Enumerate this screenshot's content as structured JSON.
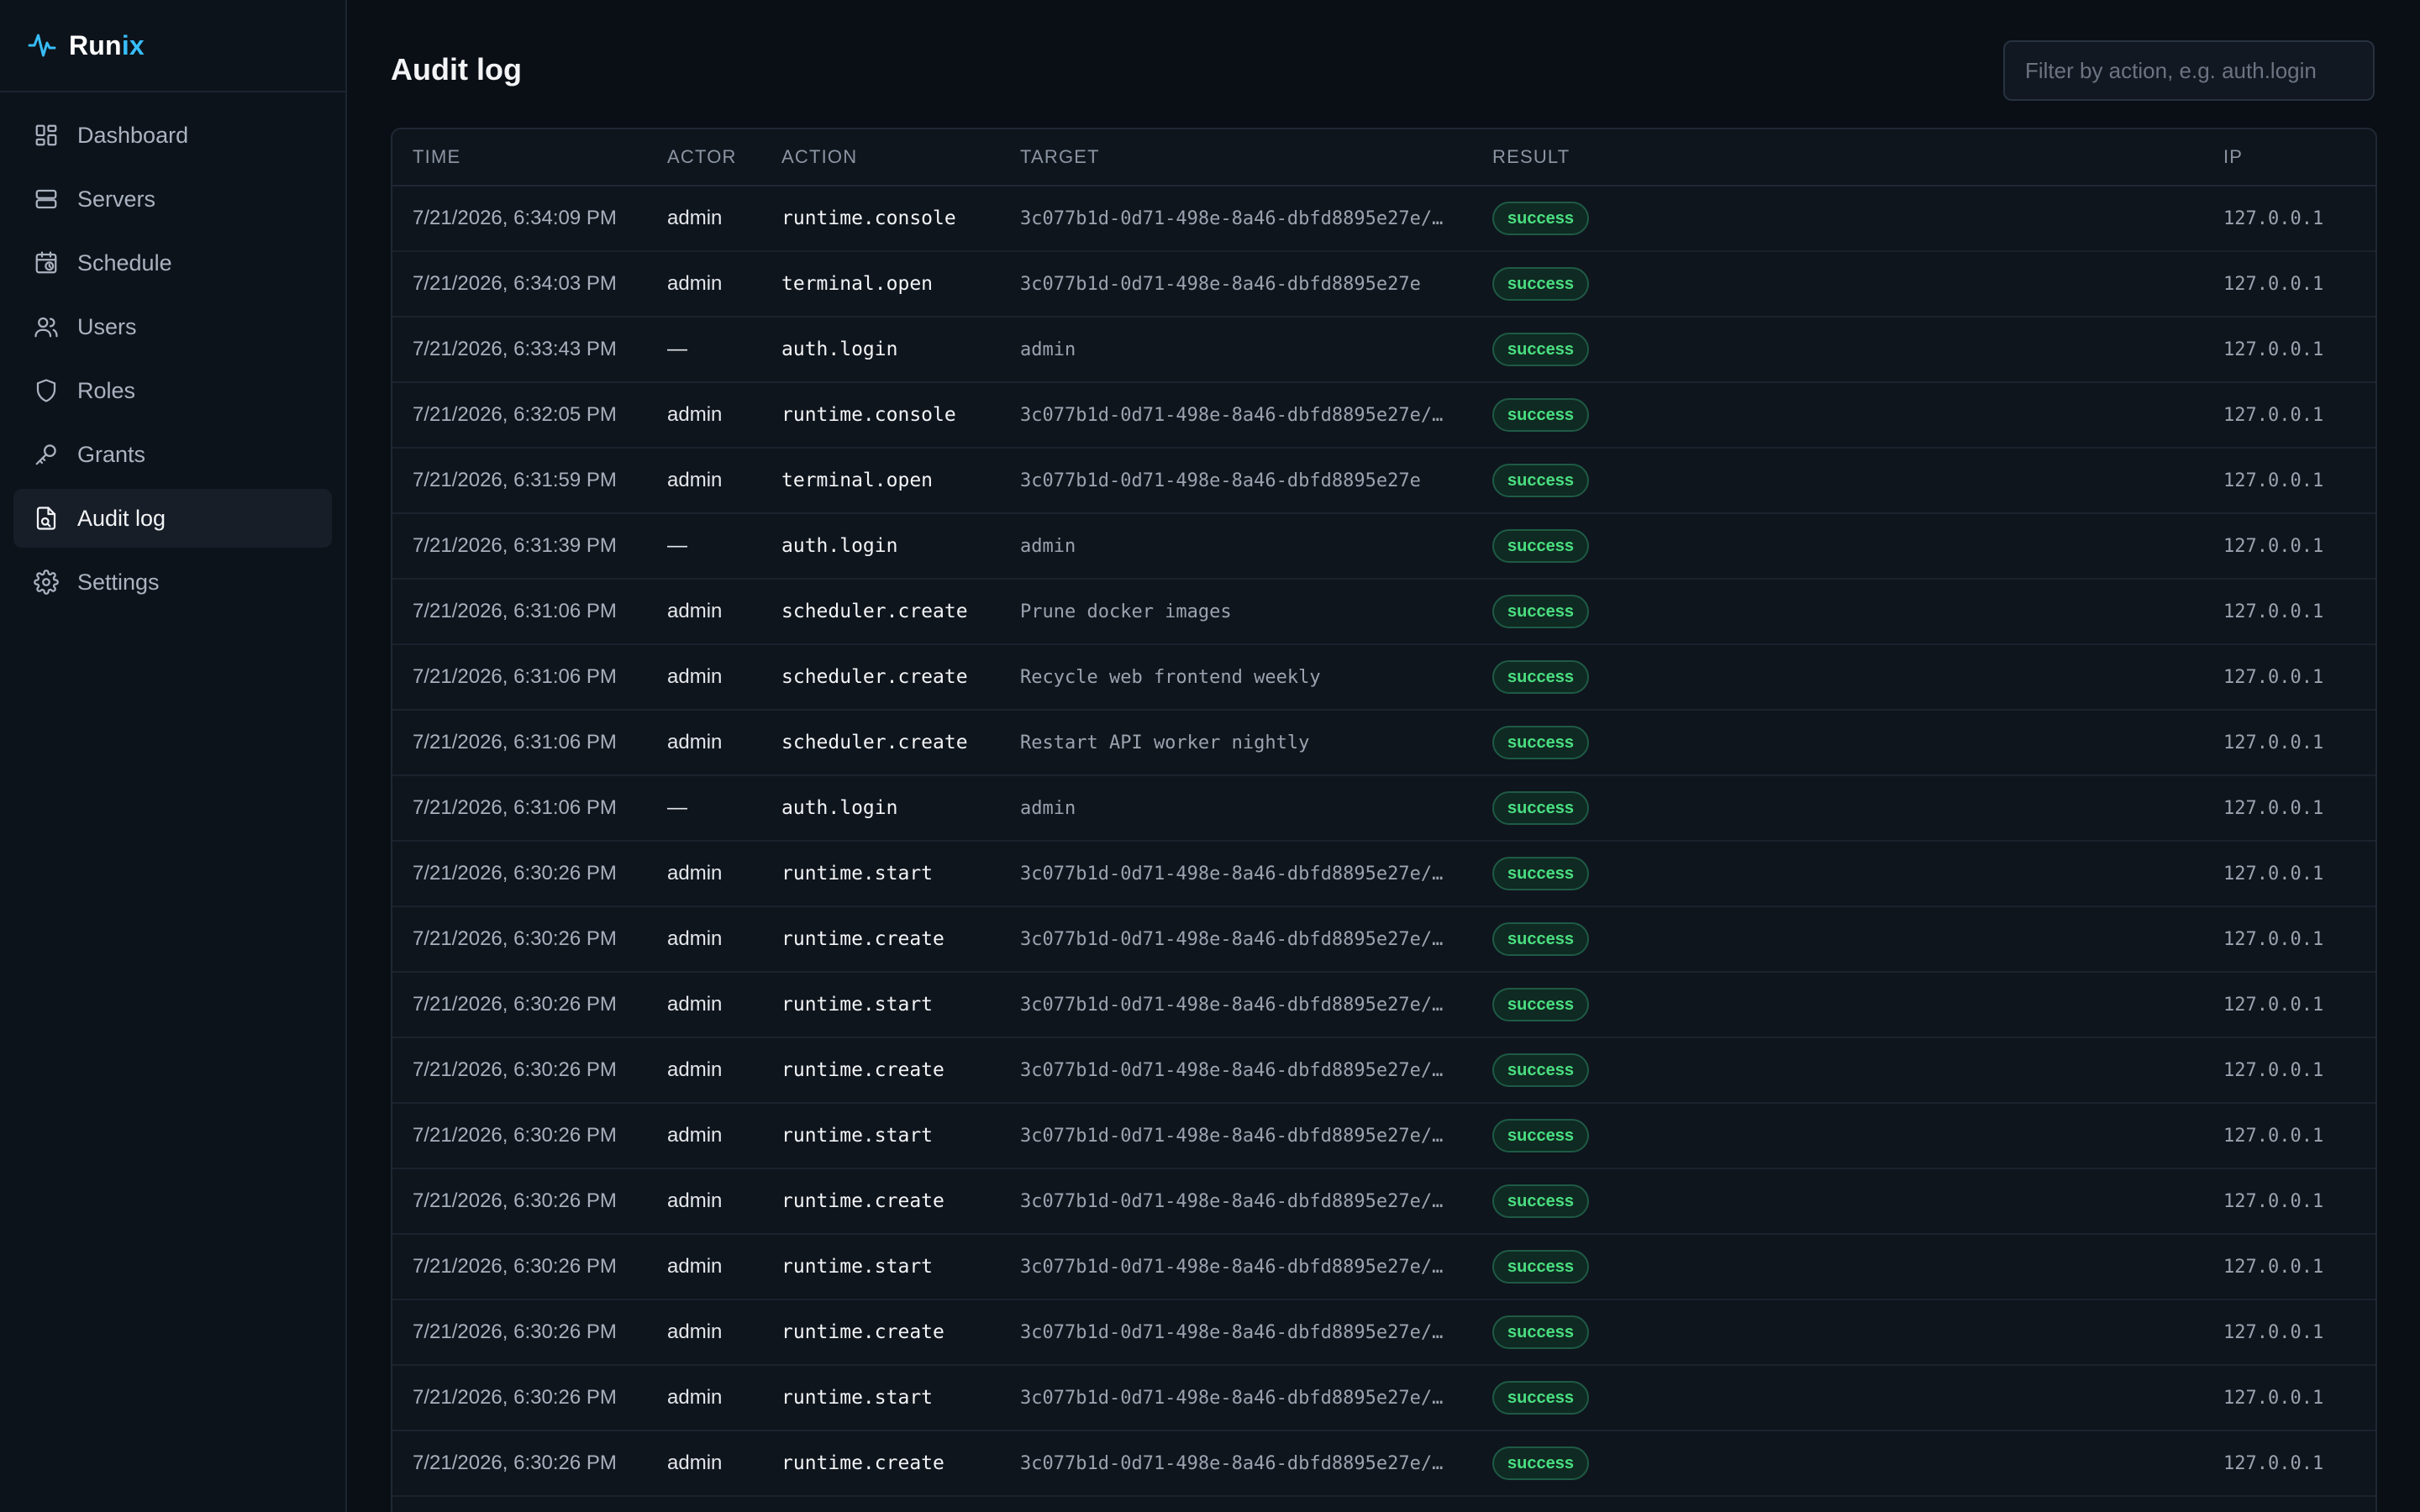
{
  "app": {
    "name_main": "Run",
    "name_accent": "ix"
  },
  "sidebar": {
    "items": [
      {
        "label": "Dashboard",
        "icon": "dashboard-icon",
        "active": false
      },
      {
        "label": "Servers",
        "icon": "servers-icon",
        "active": false
      },
      {
        "label": "Schedule",
        "icon": "calendar-clock-icon",
        "active": false
      },
      {
        "label": "Users",
        "icon": "users-icon",
        "active": false
      },
      {
        "label": "Roles",
        "icon": "shield-icon",
        "active": false
      },
      {
        "label": "Grants",
        "icon": "key-icon",
        "active": false
      },
      {
        "label": "Audit log",
        "icon": "audit-file-icon",
        "active": true
      },
      {
        "label": "Settings",
        "icon": "gear-icon",
        "active": false
      }
    ]
  },
  "main": {
    "title": "Audit log",
    "filter_placeholder": "Filter by action, e.g. auth.login"
  },
  "table": {
    "columns": [
      "TIME",
      "ACTOR",
      "ACTION",
      "TARGET",
      "RESULT",
      "IP"
    ],
    "rows": [
      {
        "time": "7/21/2026, 6:34:09 PM",
        "actor": "admin",
        "action": "runtime.console",
        "target": "3c077b1d-0d71-498e-8a46-dbfd8895e27e/…",
        "result": "success",
        "ip": "127.0.0.1"
      },
      {
        "time": "7/21/2026, 6:34:03 PM",
        "actor": "admin",
        "action": "terminal.open",
        "target": "3c077b1d-0d71-498e-8a46-dbfd8895e27e",
        "result": "success",
        "ip": "127.0.0.1"
      },
      {
        "time": "7/21/2026, 6:33:43 PM",
        "actor": "—",
        "action": "auth.login",
        "target": "admin",
        "result": "success",
        "ip": "127.0.0.1"
      },
      {
        "time": "7/21/2026, 6:32:05 PM",
        "actor": "admin",
        "action": "runtime.console",
        "target": "3c077b1d-0d71-498e-8a46-dbfd8895e27e/…",
        "result": "success",
        "ip": "127.0.0.1"
      },
      {
        "time": "7/21/2026, 6:31:59 PM",
        "actor": "admin",
        "action": "terminal.open",
        "target": "3c077b1d-0d71-498e-8a46-dbfd8895e27e",
        "result": "success",
        "ip": "127.0.0.1"
      },
      {
        "time": "7/21/2026, 6:31:39 PM",
        "actor": "—",
        "action": "auth.login",
        "target": "admin",
        "result": "success",
        "ip": "127.0.0.1"
      },
      {
        "time": "7/21/2026, 6:31:06 PM",
        "actor": "admin",
        "action": "scheduler.create",
        "target": "Prune docker images",
        "result": "success",
        "ip": "127.0.0.1"
      },
      {
        "time": "7/21/2026, 6:31:06 PM",
        "actor": "admin",
        "action": "scheduler.create",
        "target": "Recycle web frontend weekly",
        "result": "success",
        "ip": "127.0.0.1"
      },
      {
        "time": "7/21/2026, 6:31:06 PM",
        "actor": "admin",
        "action": "scheduler.create",
        "target": "Restart API worker nightly",
        "result": "success",
        "ip": "127.0.0.1"
      },
      {
        "time": "7/21/2026, 6:31:06 PM",
        "actor": "—",
        "action": "auth.login",
        "target": "admin",
        "result": "success",
        "ip": "127.0.0.1"
      },
      {
        "time": "7/21/2026, 6:30:26 PM",
        "actor": "admin",
        "action": "runtime.start",
        "target": "3c077b1d-0d71-498e-8a46-dbfd8895e27e/…",
        "result": "success",
        "ip": "127.0.0.1"
      },
      {
        "time": "7/21/2026, 6:30:26 PM",
        "actor": "admin",
        "action": "runtime.create",
        "target": "3c077b1d-0d71-498e-8a46-dbfd8895e27e/…",
        "result": "success",
        "ip": "127.0.0.1"
      },
      {
        "time": "7/21/2026, 6:30:26 PM",
        "actor": "admin",
        "action": "runtime.start",
        "target": "3c077b1d-0d71-498e-8a46-dbfd8895e27e/…",
        "result": "success",
        "ip": "127.0.0.1"
      },
      {
        "time": "7/21/2026, 6:30:26 PM",
        "actor": "admin",
        "action": "runtime.create",
        "target": "3c077b1d-0d71-498e-8a46-dbfd8895e27e/…",
        "result": "success",
        "ip": "127.0.0.1"
      },
      {
        "time": "7/21/2026, 6:30:26 PM",
        "actor": "admin",
        "action": "runtime.start",
        "target": "3c077b1d-0d71-498e-8a46-dbfd8895e27e/…",
        "result": "success",
        "ip": "127.0.0.1"
      },
      {
        "time": "7/21/2026, 6:30:26 PM",
        "actor": "admin",
        "action": "runtime.create",
        "target": "3c077b1d-0d71-498e-8a46-dbfd8895e27e/…",
        "result": "success",
        "ip": "127.0.0.1"
      },
      {
        "time": "7/21/2026, 6:30:26 PM",
        "actor": "admin",
        "action": "runtime.start",
        "target": "3c077b1d-0d71-498e-8a46-dbfd8895e27e/…",
        "result": "success",
        "ip": "127.0.0.1"
      },
      {
        "time": "7/21/2026, 6:30:26 PM",
        "actor": "admin",
        "action": "runtime.create",
        "target": "3c077b1d-0d71-498e-8a46-dbfd8895e27e/…",
        "result": "success",
        "ip": "127.0.0.1"
      },
      {
        "time": "7/21/2026, 6:30:26 PM",
        "actor": "admin",
        "action": "runtime.start",
        "target": "3c077b1d-0d71-498e-8a46-dbfd8895e27e/…",
        "result": "success",
        "ip": "127.0.0.1"
      },
      {
        "time": "7/21/2026, 6:30:26 PM",
        "actor": "admin",
        "action": "runtime.create",
        "target": "3c077b1d-0d71-498e-8a46-dbfd8895e27e/…",
        "result": "success",
        "ip": "127.0.0.1"
      }
    ]
  },
  "colors": {
    "accent": "#38bdf8",
    "success_text": "#4ade80",
    "success_bg": "#0f2a22",
    "background": "#0a0f16"
  }
}
